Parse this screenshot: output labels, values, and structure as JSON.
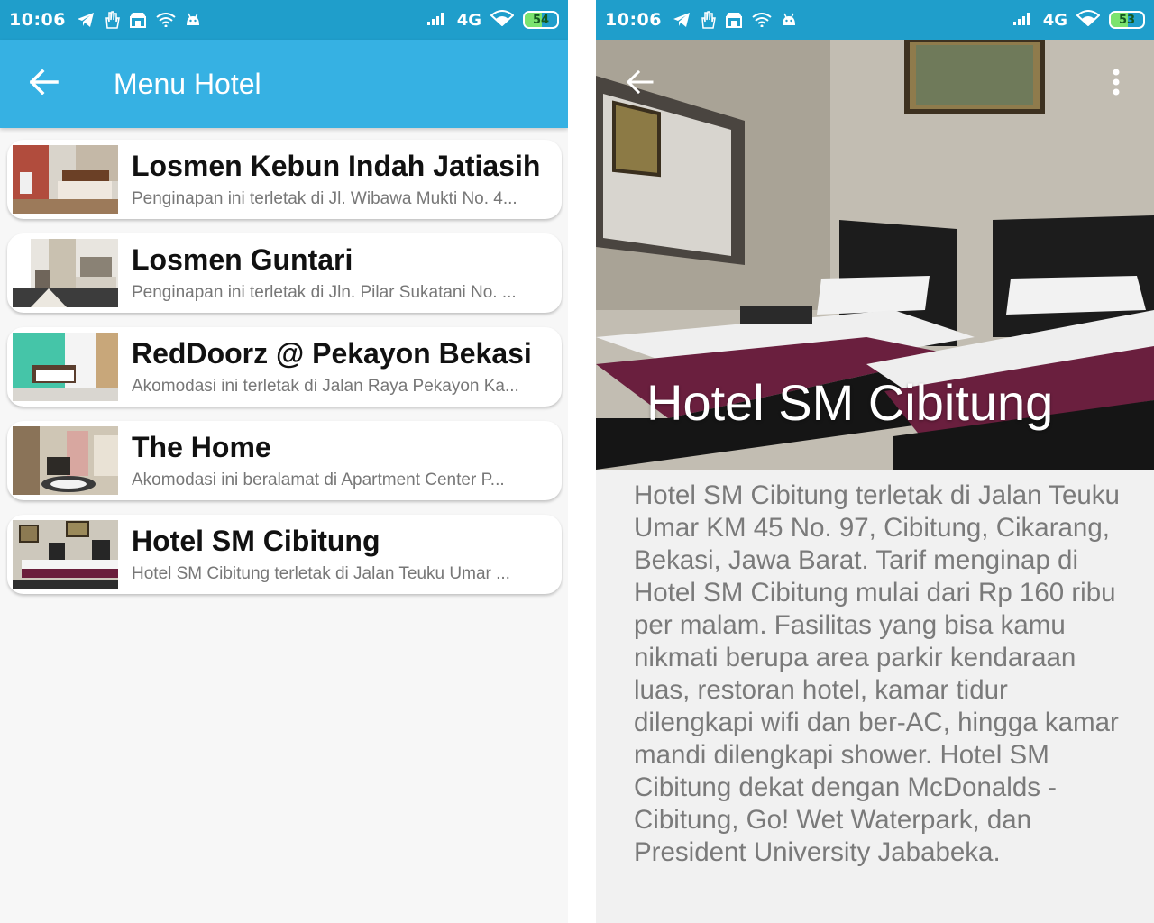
{
  "left_screen": {
    "status_bar": {
      "time": "10:06",
      "network": "4G",
      "battery": "54",
      "battery_level": 0.54
    },
    "app_bar": {
      "title": "Menu Hotel",
      "back_icon": "arrow-left-icon"
    },
    "hotels": [
      {
        "name": "Losmen Kebun Indah Jatiasih",
        "description": "Penginapan ini terletak di Jl. Wibawa Mukti No. 4..."
      },
      {
        "name": "Losmen Guntari",
        "description": "Penginapan ini terletak di Jln. Pilar Sukatani No. ..."
      },
      {
        "name": "RedDoorz @ Pekayon Bekasi",
        "description": "Akomodasi ini terletak di Jalan Raya Pekayon Ka..."
      },
      {
        "name": "The Home",
        "description": "Akomodasi ini beralamat di Apartment Center P..."
      },
      {
        "name": "Hotel SM Cibitung",
        "description": "Hotel SM Cibitung terletak di Jalan Teuku Umar ..."
      }
    ]
  },
  "right_screen": {
    "status_bar": {
      "time": "10:06",
      "network": "4G",
      "battery": "53",
      "battery_level": 0.53
    },
    "detail": {
      "title": "Hotel SM Cibitung",
      "description": "Hotel SM Cibitung terletak di Jalan Teuku Umar KM 45 No. 97, Cibitung, Cikarang, Bekasi, Jawa Barat. Tarif menginap di Hotel SM Cibitung mulai dari Rp 160 ribu per malam. Fasilitas yang bisa kamu nikmati berupa area parkir kendaraan luas, restoran hotel, kamar tidur dilengkapi wifi dan ber-AC, hingga kamar mandi dilengkapi shower. Hotel SM Cibitung dekat dengan McDonalds - Cibitung, Go! Wet Waterpark, dan President University Jababeka.",
      "back_icon": "arrow-left-icon",
      "menu_icon": "more-vert-icon"
    }
  },
  "colors": {
    "status_bar": "#1f9ecb",
    "app_bar": "#36b1e3"
  }
}
